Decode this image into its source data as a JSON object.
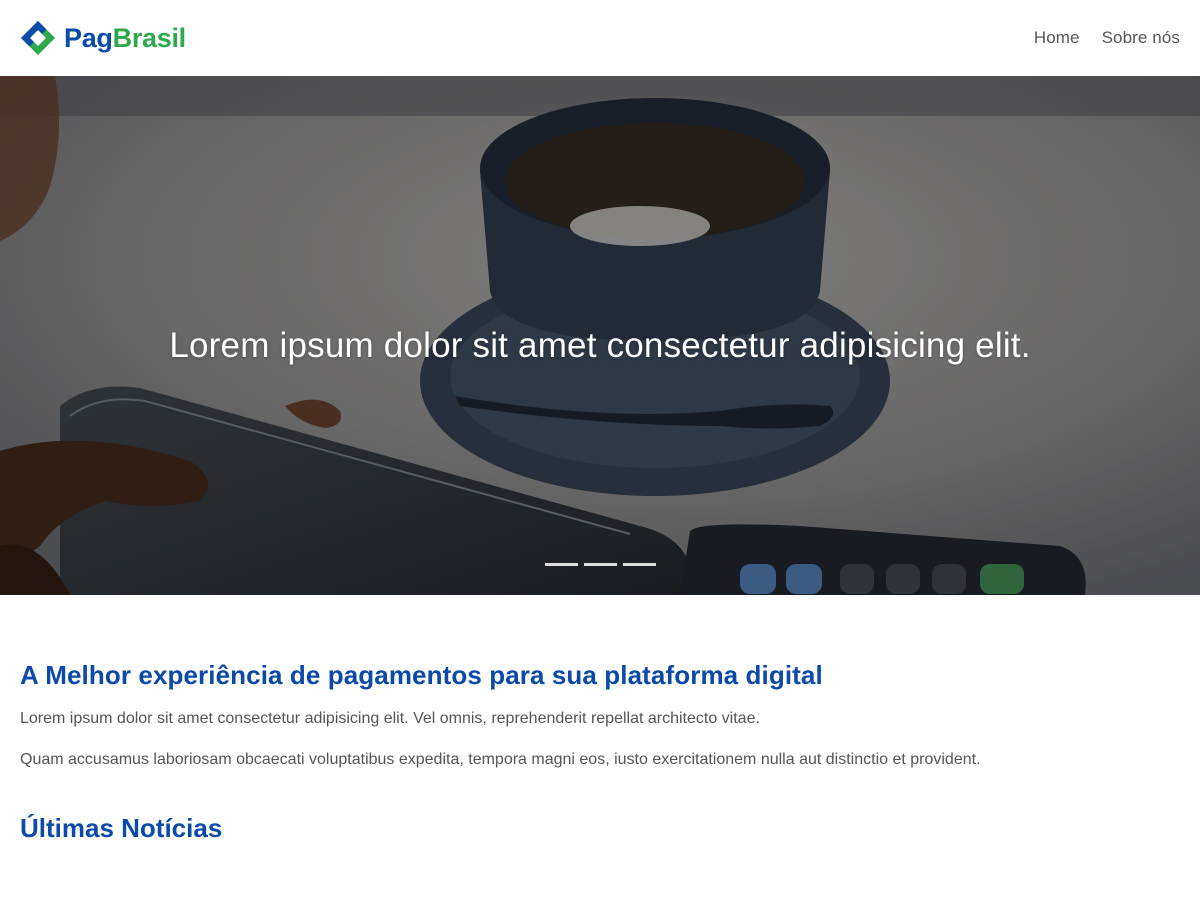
{
  "brand": {
    "name_part1": "Pag",
    "name_part2": "Brasil",
    "color_primary": "#0b4aa8",
    "color_secondary": "#2ea84d",
    "logo_icon": "pagbrasil-logo-icon"
  },
  "nav": {
    "items": [
      {
        "label": "Home"
      },
      {
        "label": "Sobre nós"
      }
    ]
  },
  "hero": {
    "caption": "Lorem ipsum dolor sit amet consectetur adipisicing elit.",
    "indicators_count": 3,
    "active_indicator": 1
  },
  "main": {
    "title": "A Melhor experiência de pagamentos para sua plataforma digital",
    "paragraph1": "Lorem ipsum dolor sit amet consectetur adipisicing elit. Vel omnis, reprehenderit repellat architecto vitae.",
    "paragraph2": "Quam accusamus laboriosam obcaecati voluptatibus expedita, tempora magni eos, iusto exercitationem nulla aut distinctio et provident.",
    "news_title": "Últimas Notícias"
  }
}
